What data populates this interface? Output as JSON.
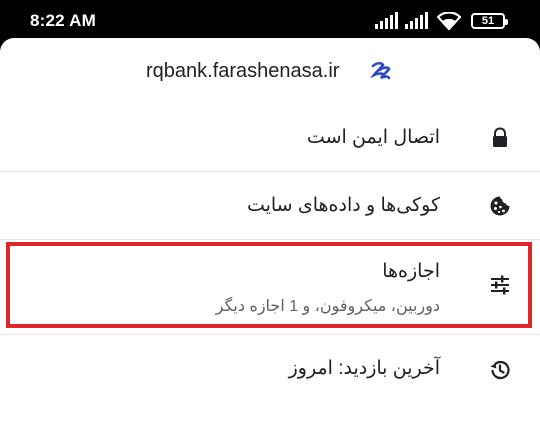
{
  "status_bar": {
    "time": "8:22 AM",
    "battery": "51",
    "icons": [
      "signal-icon",
      "signal-icon",
      "wifi-icon",
      "battery-icon"
    ]
  },
  "site": {
    "domain": "rqbank.farashenasa.ir",
    "favicon": "site-favicon-icon",
    "favicon_color": "#2a49c9"
  },
  "items": [
    {
      "label": "اتصال ایمن است",
      "icon": "lock-icon"
    },
    {
      "label": "کوکی‌ها و داده‌های سایت",
      "icon": "cookie-icon"
    },
    {
      "label": "اجازه‌ها",
      "sublabel": "دوربین، میکروفون، و 1 اجازه دیگر",
      "icon": "sliders-icon",
      "highlighted": true
    },
    {
      "label": "آخرین بازدید: امروز",
      "icon": "history-icon"
    }
  ],
  "colors": {
    "highlight_border": "#e0252b",
    "text_primary": "#202124",
    "text_secondary": "#5f6368"
  }
}
